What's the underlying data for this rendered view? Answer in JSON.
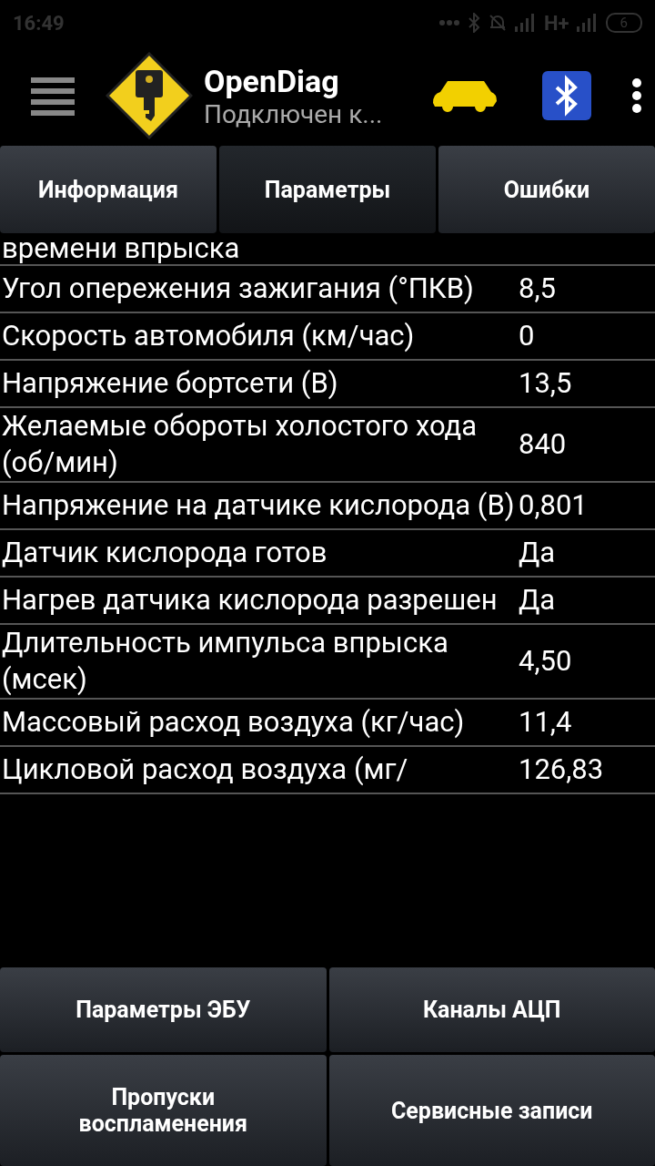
{
  "status_bar": {
    "time": "16:49",
    "network": "H+",
    "battery": "6"
  },
  "app_bar": {
    "title": "OpenDiag",
    "subtitle": "Подключен к..."
  },
  "tabs": [
    {
      "label": "Информация",
      "selected": false
    },
    {
      "label": "Параметры",
      "selected": true
    },
    {
      "label": "Ошибки",
      "selected": false
    }
  ],
  "parameters": [
    {
      "name": "времени впрыска"
    },
    {
      "name": "Угол опережения зажигания (°ПКВ)",
      "value": "8,5"
    },
    {
      "name": "Скорость автомобиля (км/час)",
      "value": "0"
    },
    {
      "name": "Напряжение бортсети (В)",
      "value": "13,5"
    },
    {
      "name": "Желаемые обороты холостого хода (об/мин)",
      "value": "840"
    },
    {
      "name": "Напряжение на датчике кислорода (В)",
      "value": "0,801"
    },
    {
      "name": "Датчик кислорода готов",
      "value": "Да"
    },
    {
      "name": "Нагрев датчика кислорода разрешен",
      "value": "Да"
    },
    {
      "name": "Длительность импульса впрыска (мсек)",
      "value": "4,50"
    },
    {
      "name": "Массовый расход воздуха (кг/час)",
      "value": "11,4"
    },
    {
      "name": "Цикловой расход воздуха (мг/",
      "value": "126,83"
    }
  ],
  "buttons": [
    "Параметры ЭБУ",
    "Каналы АЦП",
    "Пропуски воспламенения",
    "Сервисные записи"
  ]
}
